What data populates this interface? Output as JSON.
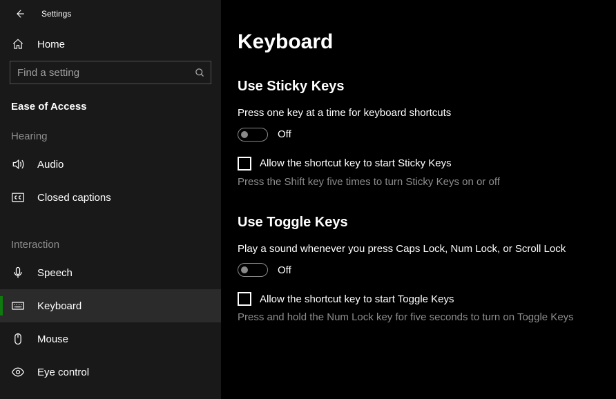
{
  "titlebar": {
    "title": "Settings"
  },
  "sidebar": {
    "home_label": "Home",
    "search_placeholder": "Find a setting",
    "group_title": "Ease of Access",
    "categories": [
      {
        "label": "Hearing",
        "items": [
          {
            "icon": "audio-icon",
            "label": "Audio"
          },
          {
            "icon": "closed-captions-icon",
            "label": "Closed captions"
          }
        ]
      },
      {
        "label": "Interaction",
        "items": [
          {
            "icon": "speech-icon",
            "label": "Speech"
          },
          {
            "icon": "keyboard-icon",
            "label": "Keyboard",
            "selected": true
          },
          {
            "icon": "mouse-icon",
            "label": "Mouse"
          },
          {
            "icon": "eye-control-icon",
            "label": "Eye control"
          }
        ]
      }
    ]
  },
  "main": {
    "page_title": "Keyboard",
    "sections": [
      {
        "title": "Use Sticky Keys",
        "desc": "Press one key at a time for keyboard shortcuts",
        "toggle_state": "Off",
        "check_label": "Allow the shortcut key to start Sticky Keys",
        "hint": "Press the Shift key five times to turn Sticky Keys on or off"
      },
      {
        "title": "Use Toggle Keys",
        "desc": "Play a sound whenever you press Caps Lock, Num Lock, or Scroll Lock",
        "toggle_state": "Off",
        "check_label": "Allow the shortcut key to start Toggle Keys",
        "hint": "Press and hold the Num Lock key for five seconds to turn on Toggle Keys"
      }
    ]
  }
}
